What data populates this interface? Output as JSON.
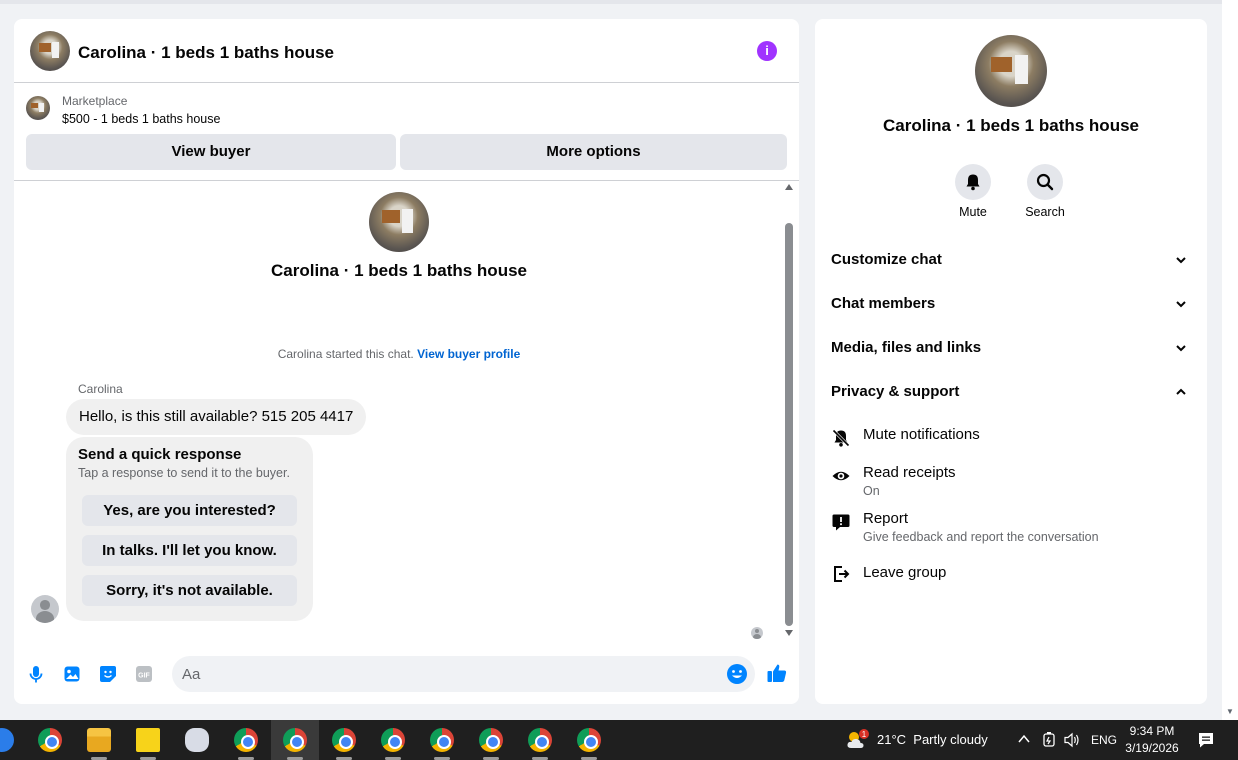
{
  "chat": {
    "header_title": "Carolina · 1 beds 1 baths house",
    "marketplace_label": "Marketplace",
    "listing_line": "$500 - 1 beds 1 baths house",
    "view_buyer_label": "View buyer",
    "more_options_label": "More options",
    "conversation_title": "Carolina · 1 beds 1 baths house",
    "started_text": "Carolina started this chat.",
    "view_buyer_profile_label": "View buyer profile",
    "sender_name": "Carolina",
    "message_text": "Hello, is this still available? 515 205 4417",
    "quick_response": {
      "title": "Send a quick response",
      "subtitle": "Tap a response to send it to the buyer.",
      "options": [
        "Yes, are you interested?",
        "In talks. I'll let you know.",
        "Sorry, it's not available."
      ]
    },
    "composer_placeholder": "Aa"
  },
  "info_panel": {
    "title": "Carolina · 1 beds 1 baths house",
    "mute_label": "Mute",
    "search_label": "Search",
    "sections": [
      "Customize chat",
      "Chat members",
      "Media, files and links",
      "Privacy & support"
    ],
    "options": {
      "mute_notifications": "Mute notifications",
      "read_receipts": "Read receipts",
      "read_receipts_status": "On",
      "report": "Report",
      "report_sub": "Give feedback and report the conversation",
      "leave_group": "Leave group"
    }
  },
  "taskbar": {
    "weather": "21°C  Partly cloudy",
    "weather_badge": "1",
    "language": "ENG",
    "time": "9:34 PM",
    "date": "3/19/2026"
  },
  "colors": {
    "accent_purple": "#a033ff",
    "messenger_blue": "#0084ff",
    "link_blue": "#0064d1"
  }
}
